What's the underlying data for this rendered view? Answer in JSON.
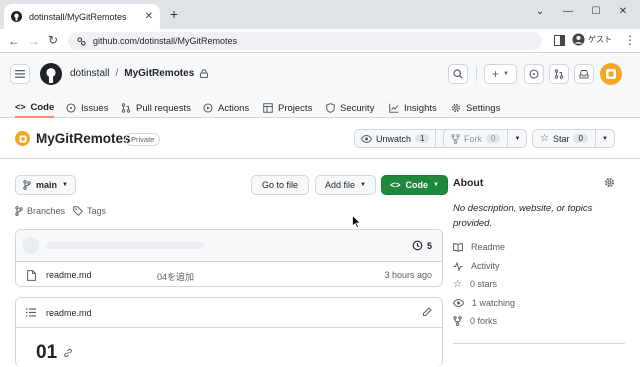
{
  "browser": {
    "tab_title": "dotinstall/MyGitRemotes",
    "new_tab": "+",
    "url": "github.com/dotinstall/MyGitRemotes",
    "profile_label": "ゲスト"
  },
  "header": {
    "owner": "dotinstall",
    "separator": "/",
    "repo": "MyGitRemotes"
  },
  "nav": {
    "tabs": [
      {
        "label": "Code"
      },
      {
        "label": "Issues"
      },
      {
        "label": "Pull requests"
      },
      {
        "label": "Actions"
      },
      {
        "label": "Projects"
      },
      {
        "label": "Security"
      },
      {
        "label": "Insights"
      },
      {
        "label": "Settings"
      }
    ]
  },
  "repo": {
    "name": "MyGitRemotes",
    "visibility": "Private",
    "watch_label": "Unwatch",
    "watch_count": "1",
    "fork_label": "Fork",
    "fork_count": "0",
    "star_label": "Star",
    "star_count": "0"
  },
  "toolbar": {
    "branch": "main",
    "go_to_file": "Go to file",
    "add_file": "Add file",
    "code": "Code",
    "branches": "Branches",
    "tags": "Tags"
  },
  "commits": {
    "count": "5"
  },
  "files": [
    {
      "name": "readme.md",
      "message": "04を追加",
      "time": "3 hours ago"
    }
  ],
  "readme": {
    "title": "readme.md",
    "heading": "01"
  },
  "about": {
    "title": "About",
    "description": "No description, website, or topics provided.",
    "links": [
      {
        "label": "Readme"
      },
      {
        "label": "Activity"
      },
      {
        "label": "0 stars"
      },
      {
        "label": "1 watching"
      },
      {
        "label": "0 forks"
      }
    ]
  },
  "colors": {
    "accent_green": "#1f883d",
    "tab_underline": "#fd8c73",
    "avatar_orange": "#f5a623"
  }
}
